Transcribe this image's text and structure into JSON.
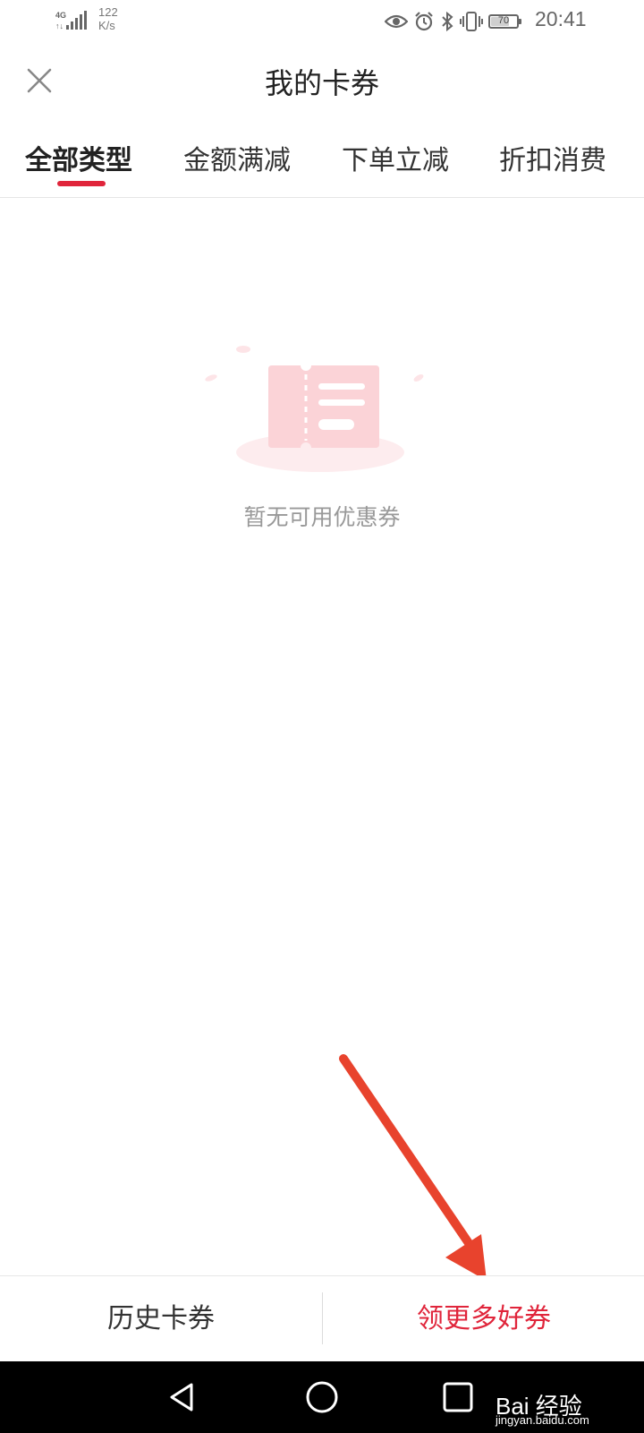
{
  "status_bar": {
    "network": "4G",
    "speed_value": "122",
    "speed_unit": "K/s",
    "battery": "70",
    "time": "20:41",
    "icons": [
      "eye-icon",
      "alarm-icon",
      "bluetooth-icon",
      "vibrate-icon",
      "battery-icon"
    ]
  },
  "header": {
    "title": "我的卡券",
    "close_icon": "close-icon"
  },
  "tabs": [
    {
      "label": "全部类型",
      "active": true
    },
    {
      "label": "金额满减",
      "active": false
    },
    {
      "label": "下单立减",
      "active": false
    },
    {
      "label": "折扣消费",
      "active": false
    }
  ],
  "empty_state": {
    "message": "暂无可用优惠券",
    "icon": "coupon-illustration"
  },
  "bottom_bar": {
    "history_label": "历史卡券",
    "more_label": "领更多好券"
  },
  "nav_bar": {
    "buttons": [
      "back-icon",
      "home-icon",
      "recent-apps-icon"
    ]
  },
  "watermark": {
    "text": "Bai 经验",
    "url": "jingyan.baidu.com"
  },
  "colors": {
    "accent": "#e0253b",
    "annotation_arrow": "#e8432d",
    "illustration_pink": "#fde2e4"
  }
}
